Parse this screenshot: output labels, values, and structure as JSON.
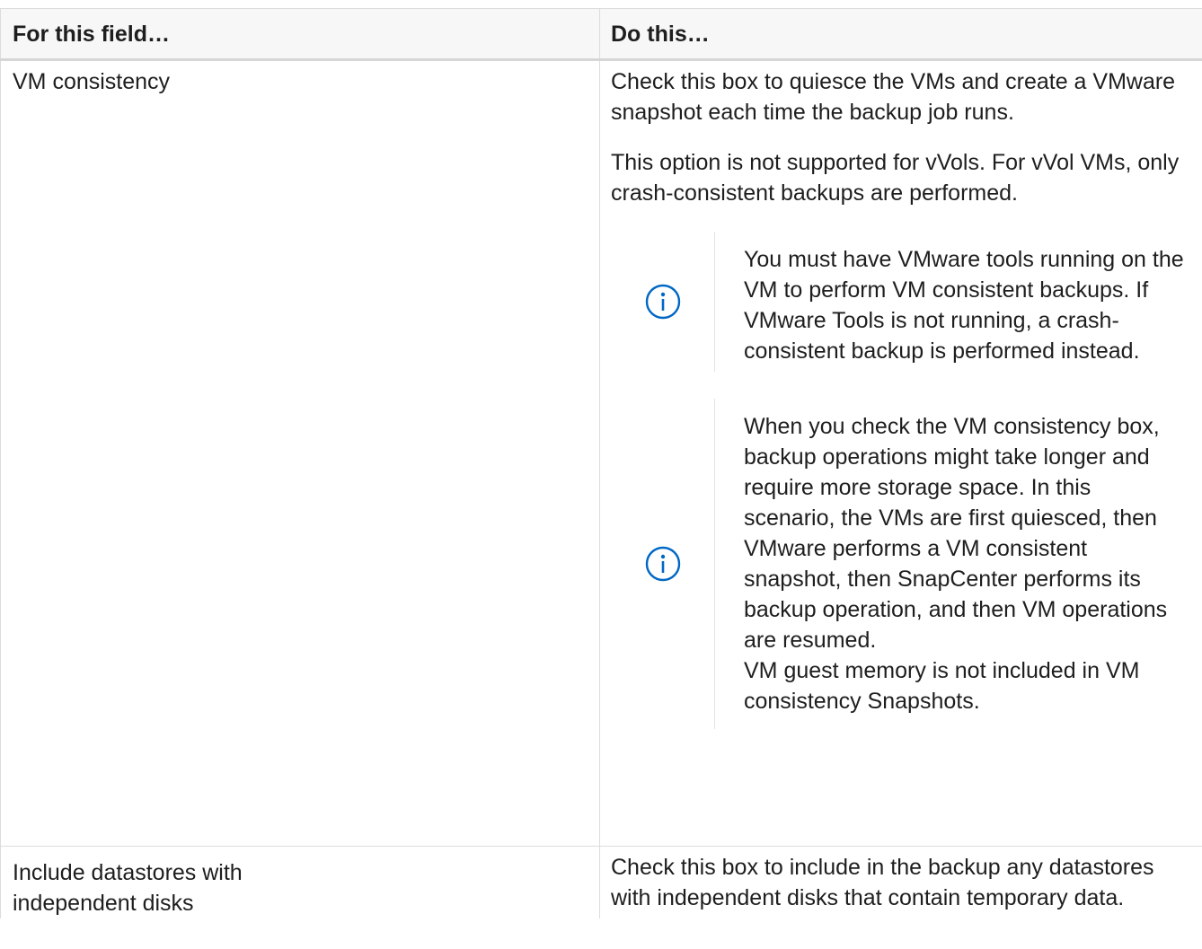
{
  "table": {
    "headers": {
      "field": "For this field…",
      "do": "Do this…"
    },
    "rows": [
      {
        "field": "VM consistency",
        "do_paragraphs": [
          "Check this box to quiesce the VMs and create a VMware snapshot each time the backup job runs.",
          "This option is not supported for vVols. For vVol VMs, only crash-consistent backups are performed."
        ],
        "notes": [
          {
            "icon": "info-icon",
            "text": "You must have VMware tools running on the VM to perform VM consistent backups. If VMware Tools is not running, a crash-consistent backup is performed instead."
          },
          {
            "icon": "info-icon",
            "text": "When you check the VM consistency box, backup operations might take longer and require more storage space. In this scenario, the VMs are first quiesced, then VMware performs a VM consistent snapshot, then SnapCenter performs its backup operation, and then VM operations are resumed.",
            "text_extra": "VM guest memory is not included in VM consistency Snapshots."
          }
        ]
      },
      {
        "field": "Include datastores with independent disks",
        "do_paragraphs": [
          "Check this box to include in the backup any datastores with independent disks that contain temporary data."
        ]
      }
    ]
  },
  "colors": {
    "accent": "#0067c5",
    "text": "#1e1e1e",
    "header_bg": "#f7f7f7",
    "border": "#dcdcdc"
  }
}
